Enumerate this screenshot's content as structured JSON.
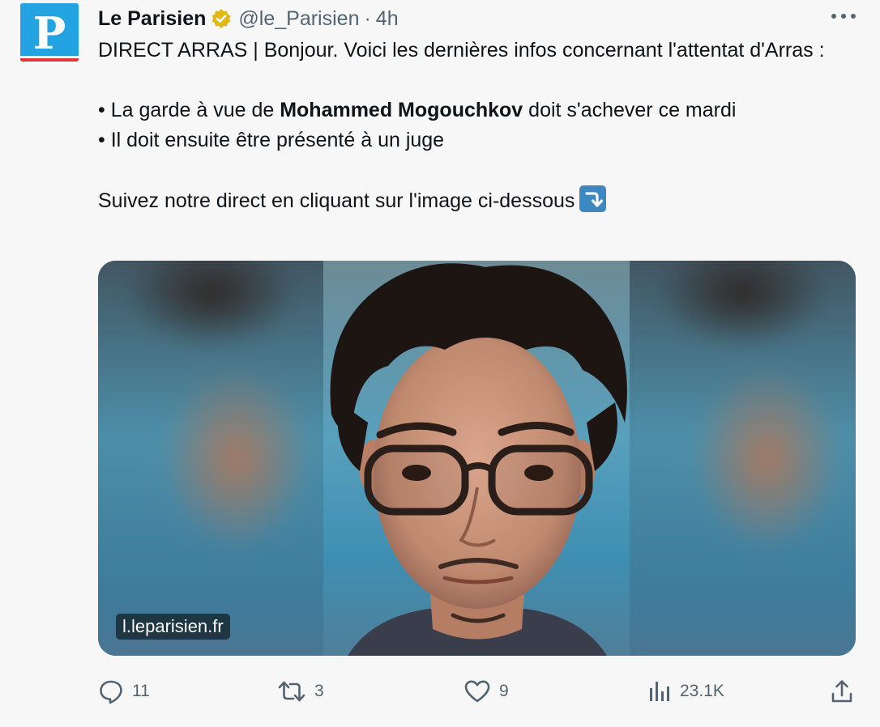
{
  "account": {
    "avatar_letter": "P",
    "name": "Le Parisien",
    "handle": "@le_Parisien",
    "separator": "·",
    "time": "4h",
    "verified_icon": "verified-badge-icon",
    "brand_color": "#24a3e3",
    "badge_color": "#e2b719"
  },
  "tweet": {
    "line1": "DIRECT ARRAS | Bonjour. Voici les dernières infos concernant l'attentat d'Arras :",
    "bullet1_prefix": "• La garde à vue de ",
    "bullet1_bold": "Mohammed Mogouchkov",
    "bullet1_suffix": " doit s'achever ce mardi",
    "bullet2": "• Il doit ensuite être présenté à un juge",
    "cta": "Suivez notre direct en cliquant sur l'image ci-dessous",
    "cta_emoji": "right-arrow-curving-down-icon"
  },
  "media": {
    "source": "l.leparisien.fr"
  },
  "actions": {
    "replies": "11",
    "retweets": "3",
    "likes": "9",
    "views": "23.1K"
  },
  "colors": {
    "text": "#0f1419",
    "muted": "#536471",
    "background": "#f7f7f7"
  }
}
